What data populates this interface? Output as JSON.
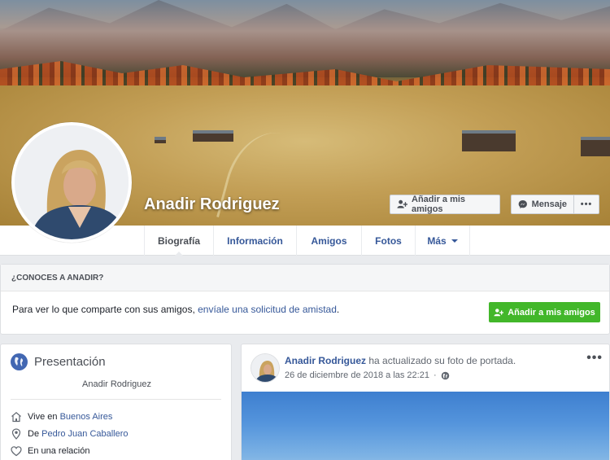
{
  "profile": {
    "name": "Anadir Rodriguez",
    "add_friend_label": "Añadir a mis amigos",
    "message_label": "Mensaje",
    "more_label": "•••"
  },
  "nav": {
    "tabs": [
      {
        "label": "Biografía",
        "active": true
      },
      {
        "label": "Información"
      },
      {
        "label": "Amigos"
      },
      {
        "label": "Fotos"
      },
      {
        "label": "Más"
      }
    ]
  },
  "know": {
    "heading": "¿CONOCES A ANADIR?",
    "text_before": "Para ver lo que comparte con sus amigos, ",
    "link": "envíale una solicitud de amistad",
    "text_after": ".",
    "button_label": "Añadir a mis amigos"
  },
  "intro": {
    "title": "Presentación",
    "name": "Anadir Rodriguez",
    "rows": [
      {
        "prefix": "Vive en ",
        "link": "Buenos Aires",
        "icon": "home-icon"
      },
      {
        "prefix": "De ",
        "link": "Pedro Juan Caballero",
        "icon": "location-pin-icon"
      },
      {
        "prefix": "En una relación",
        "link": "",
        "icon": "heart-icon"
      }
    ]
  },
  "post": {
    "author": "Anadir Rodriguez",
    "action": " ha actualizado su foto de portada.",
    "date": "26 de diciembre de 2018 a las 22:21",
    "more": "•••"
  },
  "colors": {
    "link": "#365899",
    "green": "#42b72a",
    "background": "#e9ebee"
  }
}
